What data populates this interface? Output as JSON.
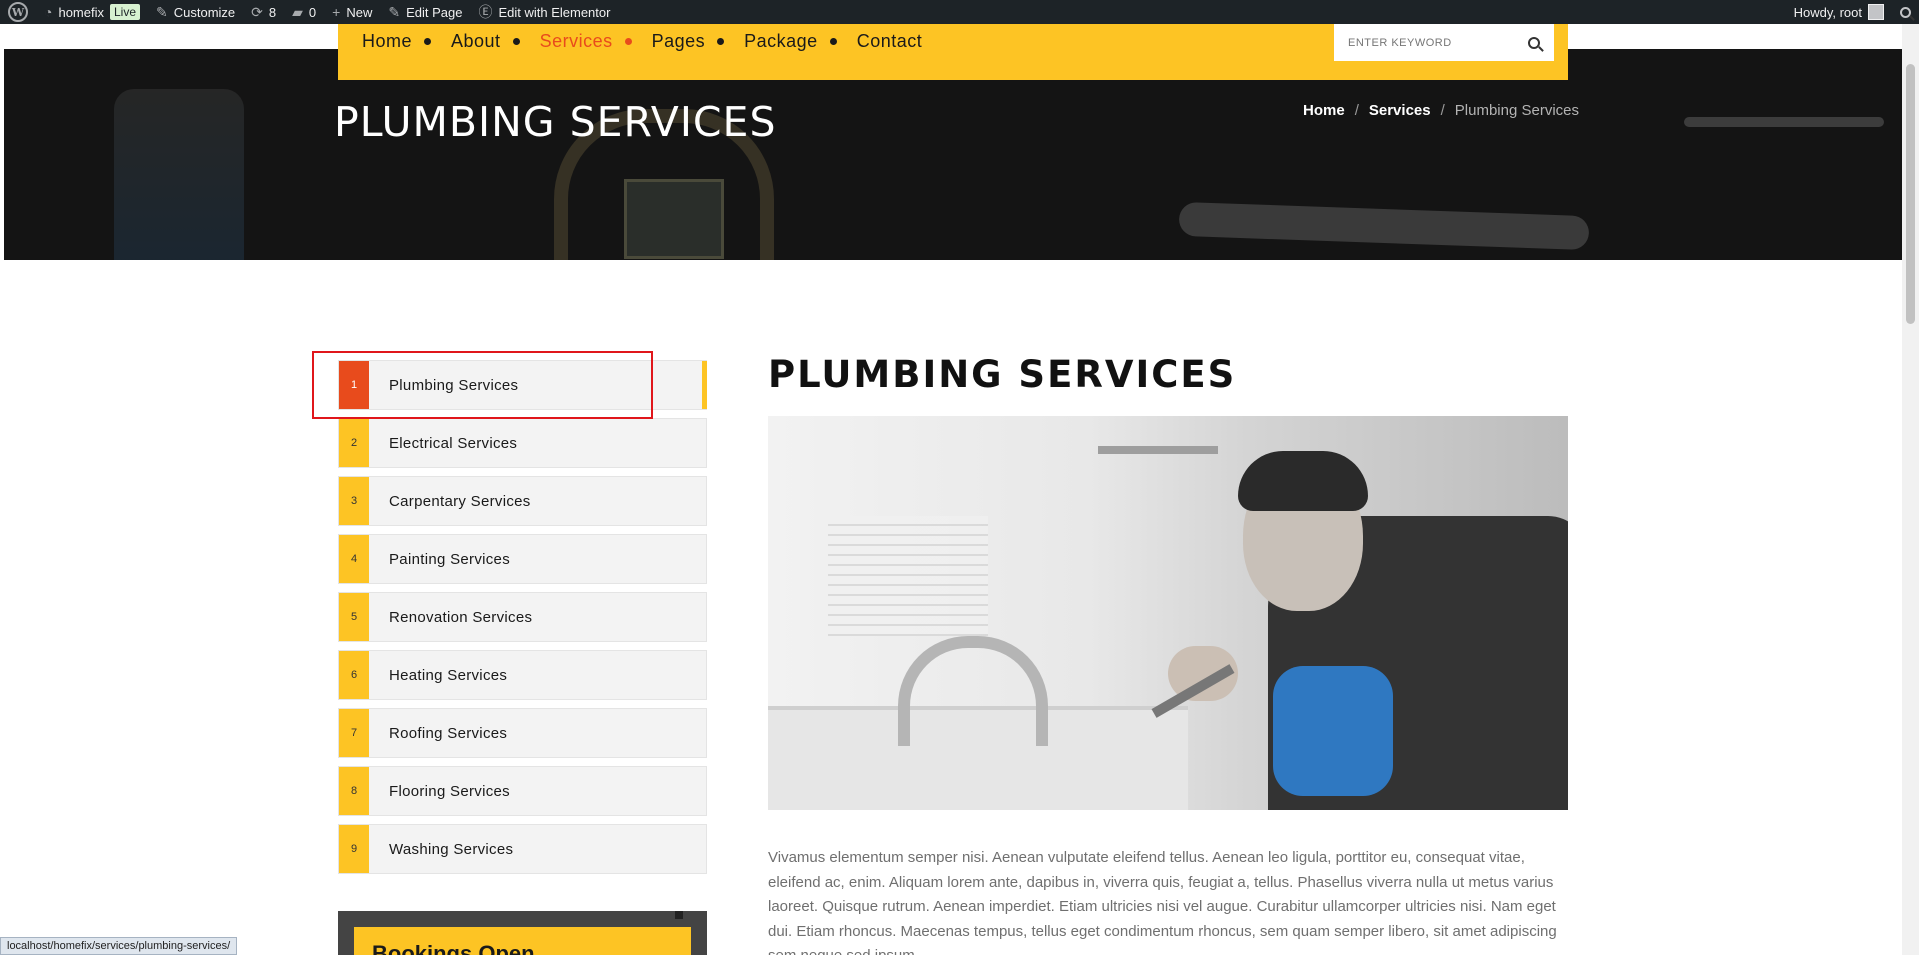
{
  "adminbar": {
    "site_name": "homefix",
    "live_badge": "Live",
    "customize": "Customize",
    "updates_count": "8",
    "comments_count": "0",
    "new_label": "New",
    "edit_page": "Edit Page",
    "elementor": "Edit with Elementor",
    "howdy": "Howdy, root"
  },
  "nav": {
    "items": [
      {
        "label": "Home"
      },
      {
        "label": "About"
      },
      {
        "label": "Services"
      },
      {
        "label": "Pages"
      },
      {
        "label": "Package"
      },
      {
        "label": "Contact"
      }
    ],
    "search_placeholder": "ENTER KEYWORD"
  },
  "hero": {
    "title": "PLUMBING SERVICES",
    "breadcrumb": [
      "Home",
      "Services",
      "Plumbing Services"
    ],
    "separator": "/"
  },
  "services": [
    {
      "num": "1",
      "label": "Plumbing Services"
    },
    {
      "num": "2",
      "label": "Electrical Services"
    },
    {
      "num": "3",
      "label": "Carpentary Services"
    },
    {
      "num": "4",
      "label": "Painting Services"
    },
    {
      "num": "5",
      "label": "Renovation Services"
    },
    {
      "num": "6",
      "label": "Heating Services"
    },
    {
      "num": "7",
      "label": "Roofing Services"
    },
    {
      "num": "8",
      "label": "Flooring Services"
    },
    {
      "num": "9",
      "label": "Washing Services"
    }
  ],
  "booking": {
    "title": "Bookings Open"
  },
  "main": {
    "title": "PLUMBING SERVICES",
    "body": "Vivamus elementum semper nisi. Aenean vulputate eleifend tellus. Aenean leo ligula, porttitor eu, consequat vitae, eleifend ac, enim. Aliquam lorem ante, dapibus in, viverra quis, feugiat a, tellus. Phasellus viverra nulla ut metus varius laoreet. Quisque rutrum. Aenean imperdiet. Etiam ultricies nisi vel augue. Curabitur ullamcorper ultricies nisi. Nam eget dui. Etiam rhoncus. Maecenas tempus, tellus eget condimentum rhoncus, sem quam semper libero, sit amet adipiscing sem neque sed ipsum."
  },
  "status_url": "localhost/homefix/services/plumbing-services/",
  "colors": {
    "accent": "#fdc424",
    "active": "#e84b1c"
  }
}
